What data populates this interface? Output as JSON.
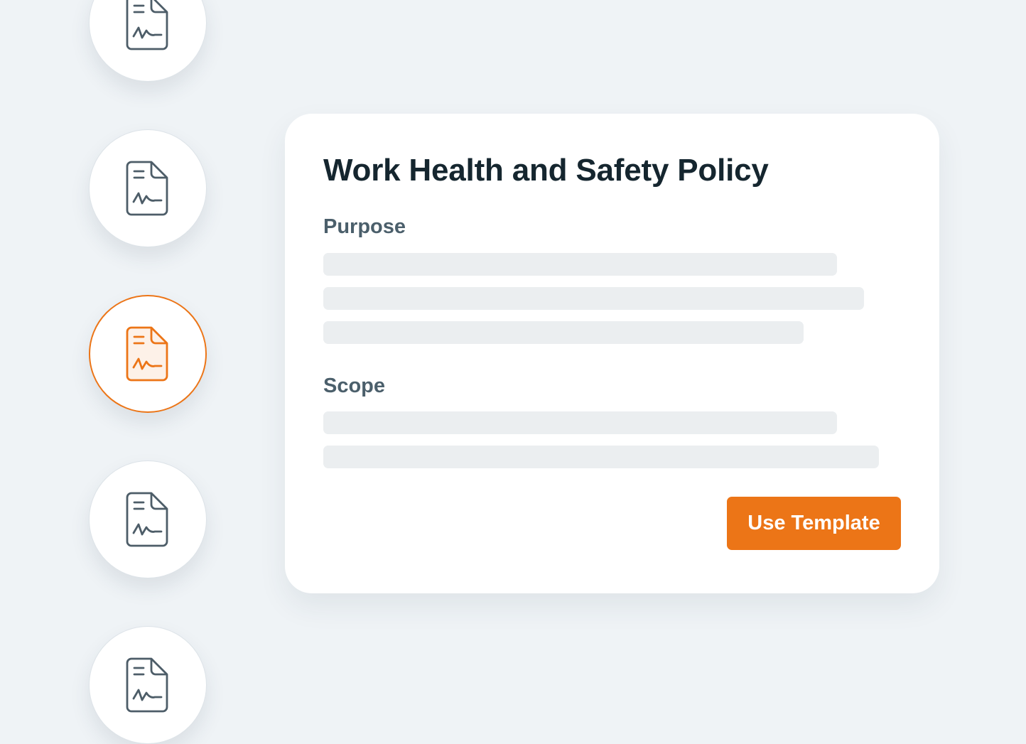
{
  "template_list": {
    "items": [
      {
        "icon": "document-signature-icon",
        "selected": false
      },
      {
        "icon": "document-signature-icon",
        "selected": false
      },
      {
        "icon": "document-signature-icon",
        "selected": true
      },
      {
        "icon": "document-signature-icon",
        "selected": false
      },
      {
        "icon": "document-signature-icon",
        "selected": false
      }
    ]
  },
  "preview": {
    "title": "Work Health and Safety Policy",
    "sections": [
      {
        "heading": "Purpose"
      },
      {
        "heading": "Scope"
      }
    ],
    "action_label": "Use Template"
  },
  "colors": {
    "accent": "#ec7517",
    "accent_tint": "#fdf1e8",
    "icon_stroke": "#4d5d68",
    "background": "#eff3f6",
    "card": "#ffffff",
    "skeleton": "#ebeef0",
    "title_text": "#15262f",
    "heading_text": "#4b5f6b"
  }
}
